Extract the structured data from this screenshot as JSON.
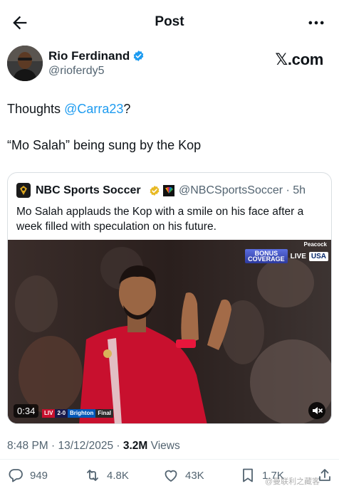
{
  "header": {
    "title": "Post"
  },
  "author": {
    "name": "Rio Ferdinand",
    "handle": "@rioferdy5",
    "source_label": "𝕏.com"
  },
  "post": {
    "line1_prefix": "Thoughts ",
    "mention": "@Carra23",
    "line1_suffix": "?",
    "line2": "“Mo Salah” being sung by the Kop"
  },
  "quoted": {
    "name": "NBC Sports Soccer",
    "handle_time": "@NBCSportsSoccer · 5h",
    "text": "Mo Salah applauds the Kop with a smile on his face after a week filled with speculation on his future.",
    "video": {
      "duration": "0:34",
      "score_home": "LIV",
      "score": "2-0",
      "score_away": "Brighton",
      "score_status": "Final",
      "bug_coverage_line1": "BONUS",
      "bug_coverage_line2": "COVERAGE",
      "bug_live": "LIVE",
      "bug_network": "USA",
      "bug_peacock": "Peacock"
    }
  },
  "meta": {
    "time_date": "8:48 PM · 13/12/2025 · ",
    "views_count": "3.2M",
    "views_label": " Views"
  },
  "actions": {
    "replies": "949",
    "reposts": "4.8K",
    "likes": "43K",
    "bookmarks": "1.7K"
  },
  "watermark": "@曼联利之藏客",
  "colors": {
    "accent": "#1d9bf0",
    "text": "#0f1419",
    "muted": "#536471",
    "verified_gold": "#e8b923",
    "jersey_red": "#c8102e"
  },
  "icons": [
    "back-arrow-icon",
    "more-icon",
    "verified-icon",
    "gold-verified-icon",
    "nbc-peacock-icon",
    "mute-icon",
    "reply-icon",
    "retweet-icon",
    "like-icon",
    "bookmark-icon",
    "share-icon"
  ]
}
